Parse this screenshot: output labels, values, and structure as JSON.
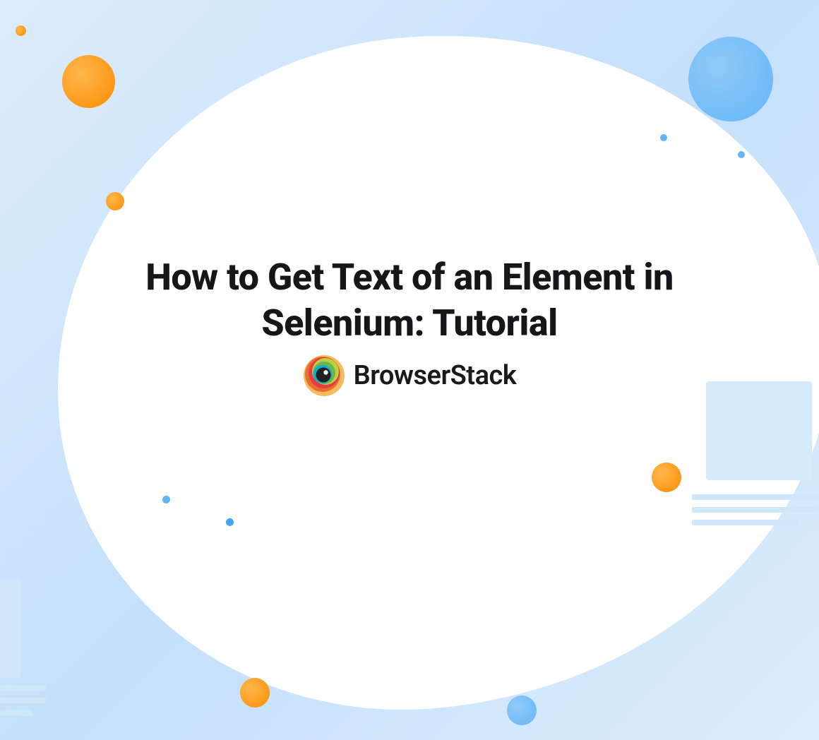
{
  "heading": "How to Get Text of an Element in Selenium: Tutorial",
  "brand": {
    "name": "BrowserStack"
  }
}
